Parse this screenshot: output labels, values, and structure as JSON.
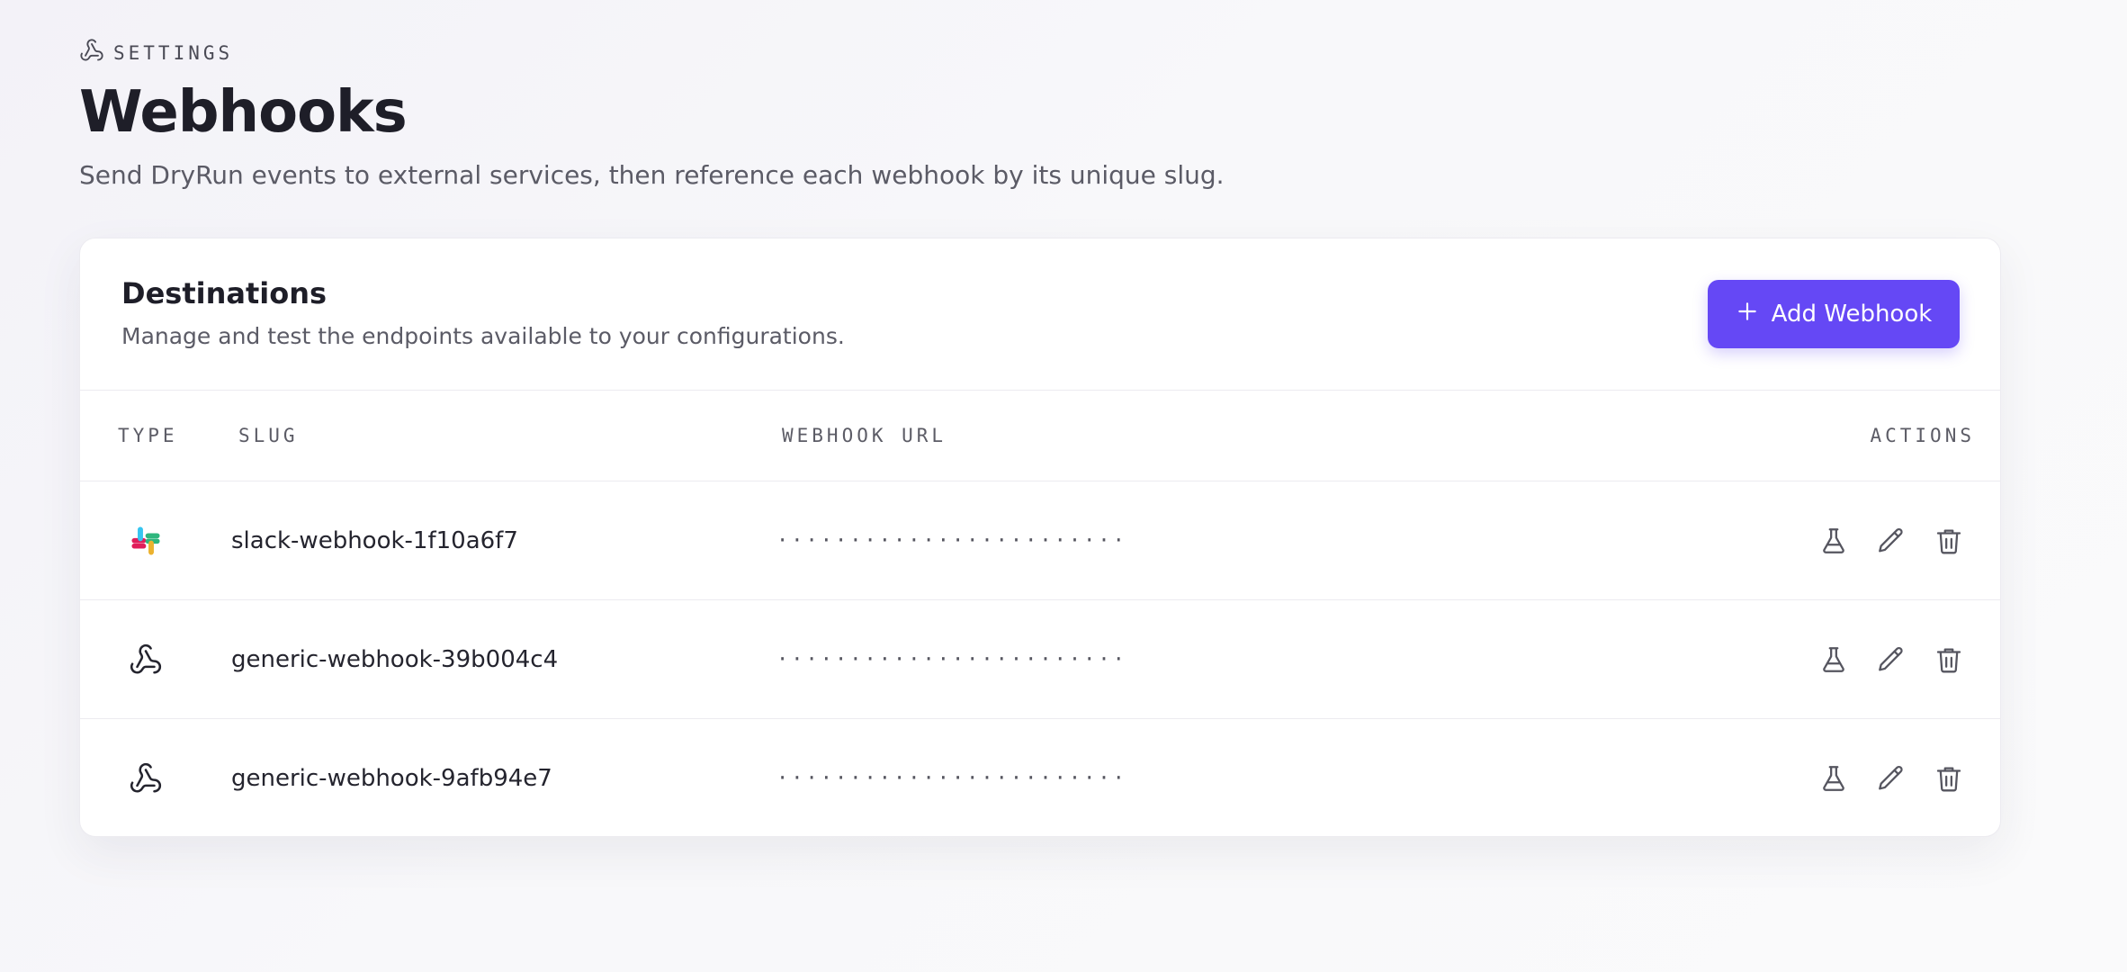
{
  "header": {
    "eyebrow_icon": "webhook-icon",
    "eyebrow": "SETTINGS",
    "title": "Webhooks",
    "subtitle": "Send DryRun events to external services, then reference each webhook by its unique slug."
  },
  "card": {
    "title": "Destinations",
    "description": "Manage and test the endpoints available to your configurations.",
    "add_button": {
      "icon": "plus-icon",
      "label": "Add Webhook"
    }
  },
  "table": {
    "columns": {
      "type": "TYPE",
      "slug": "SLUG",
      "url": "WEBHOOK URL",
      "actions": "ACTIONS"
    },
    "rows": [
      {
        "type": "slack",
        "type_icon": "slack-icon",
        "slug": "slack-webhook-1f10a6f7",
        "url": "························"
      },
      {
        "type": "generic",
        "type_icon": "webhook-icon",
        "slug": "generic-webhook-39b004c4",
        "url": "························"
      },
      {
        "type": "generic",
        "type_icon": "webhook-icon",
        "slug": "generic-webhook-9afb94e7",
        "url": "························"
      }
    ],
    "action_icons": [
      "flask-icon",
      "pencil-icon",
      "trash-icon"
    ]
  },
  "colors": {
    "accent": "#6548f5",
    "text_primary": "#1e1e28",
    "text_secondary": "#5b5b66",
    "slack_blue": "#36C5F0",
    "slack_green": "#2EB67D",
    "slack_red": "#E01E5A",
    "slack_yellow": "#ECB22E"
  }
}
